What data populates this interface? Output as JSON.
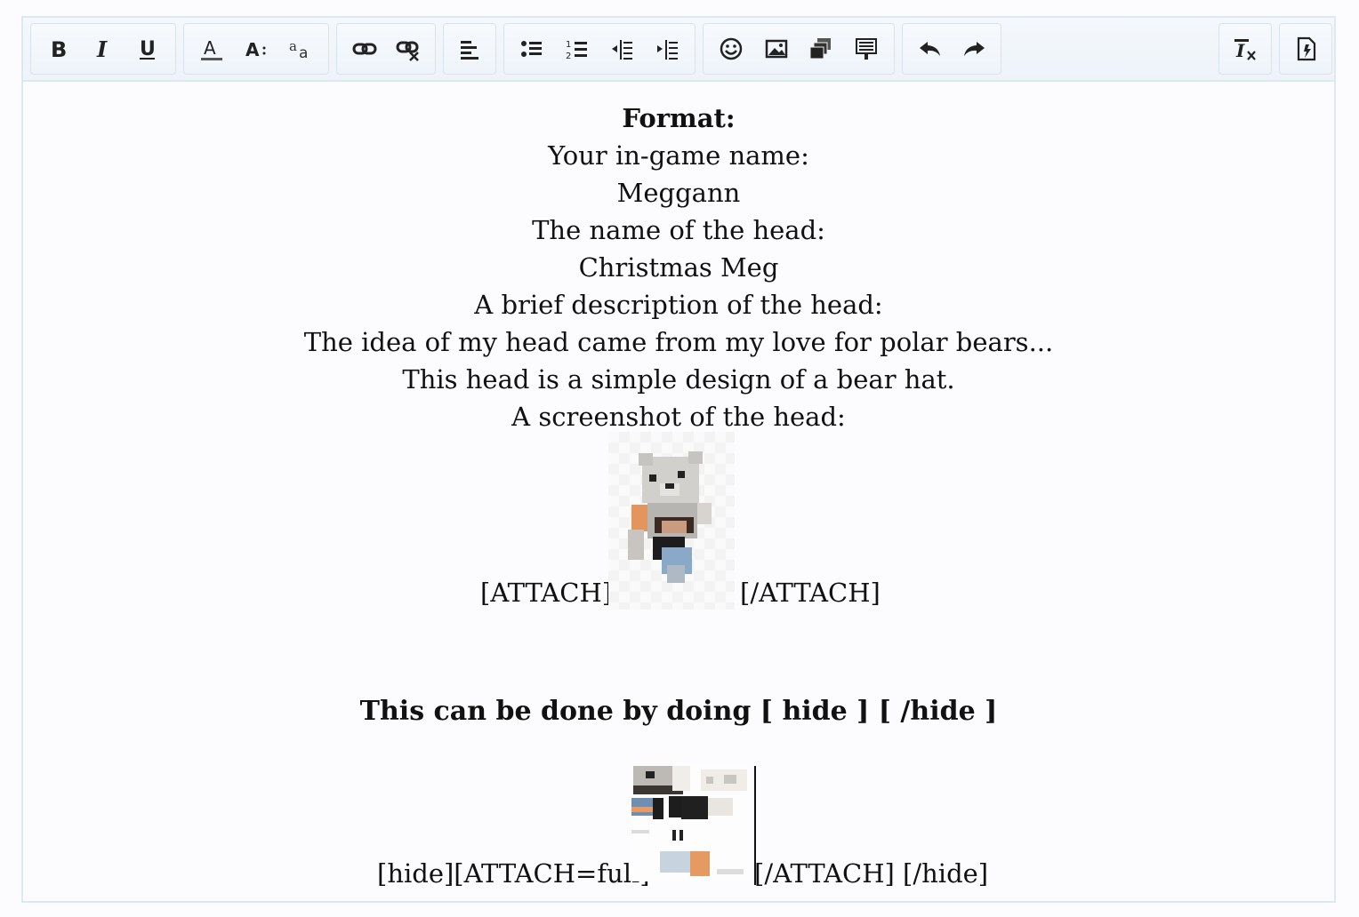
{
  "toolbar": {
    "groups": [
      [
        "bold-icon",
        "italic-icon",
        "underline-icon"
      ],
      [
        "text-color-icon",
        "font-size-icon",
        "font-family-icon"
      ],
      [
        "link-icon",
        "unlink-icon"
      ],
      [
        "align-left-icon"
      ],
      [
        "bullet-list-icon",
        "numbered-list-icon",
        "outdent-icon",
        "indent-icon"
      ],
      [
        "smilie-icon",
        "image-icon",
        "media-icon",
        "insert-icon"
      ],
      [
        "undo-icon",
        "redo-icon"
      ],
      [
        "remove-format-icon"
      ],
      [
        "toggle-bbcode-icon"
      ]
    ]
  },
  "content": {
    "format_heading": "Format:",
    "lines": [
      "Your in-game name:",
      "Meggann",
      "The name of the head:",
      "Christmas Meg",
      "A brief description of the head:",
      "The idea of my head came from my love for polar bears...",
      "This head is a simple design of a bear hat.",
      "A screenshot of the head:"
    ],
    "attach_open": "[ATTACH]",
    "attach_close": "[/ATTACH]",
    "hide_note": "This can be done by doing [ hide ] [ /hide ]",
    "hide_open": "[hide][ATTACH=full]",
    "hide_close": "[/ATTACH] [/hide]"
  }
}
